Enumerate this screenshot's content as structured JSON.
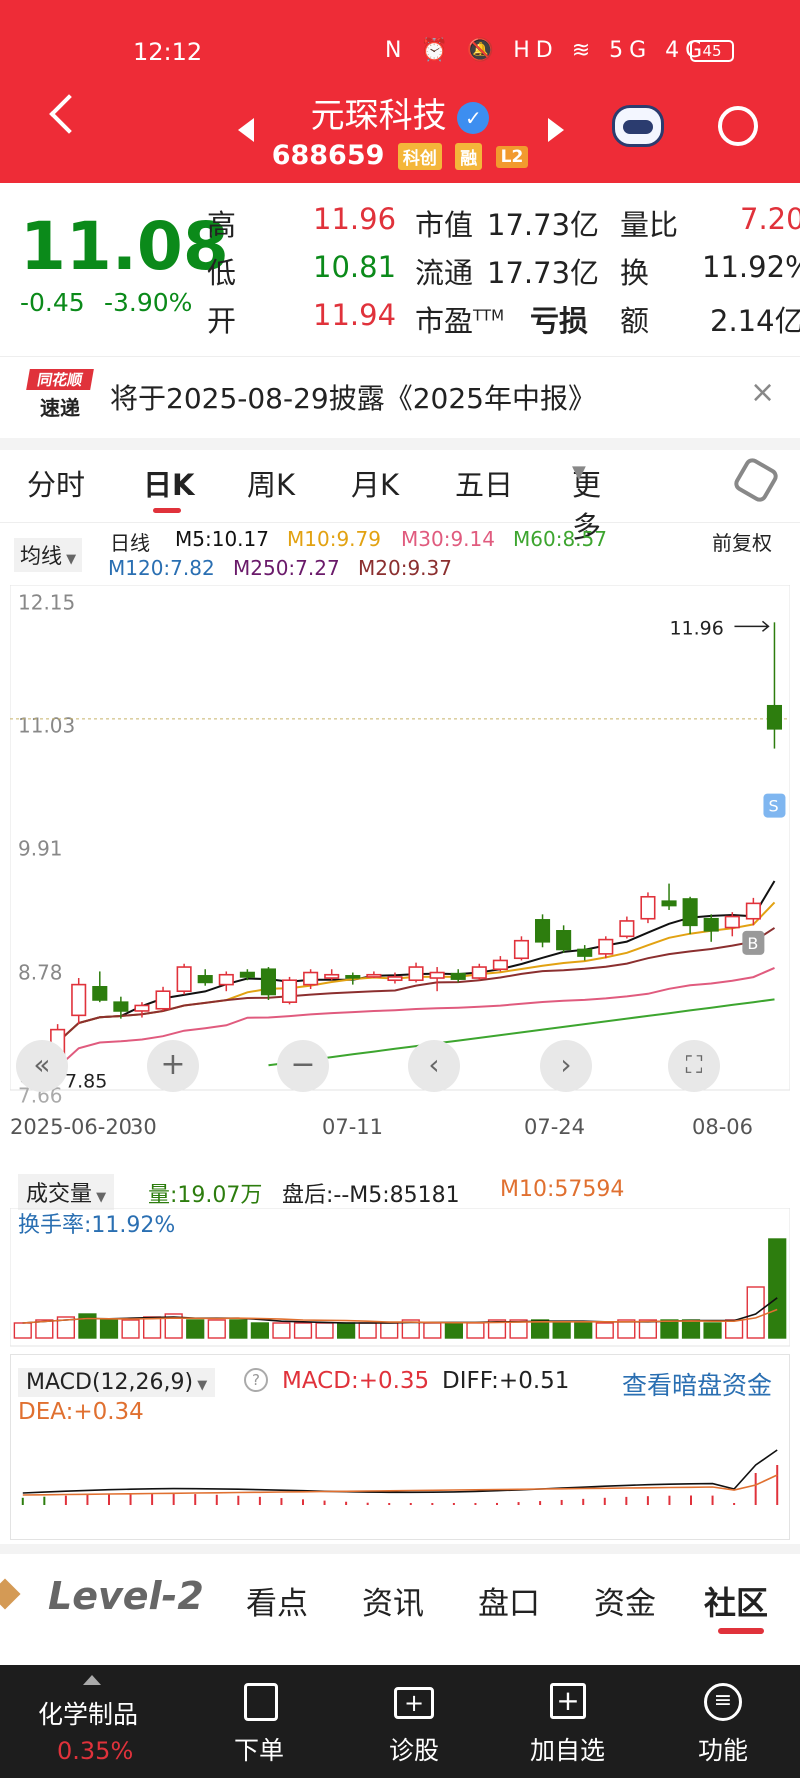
{
  "status": {
    "time": "12:12",
    "battery": "45"
  },
  "stock": {
    "name": "元琛科技",
    "code": "688659",
    "tags": [
      "科创",
      "融",
      "L2"
    ]
  },
  "quote": {
    "price": "11.08",
    "change": "-0.45",
    "change_pct": "-3.90%",
    "high_l": "高",
    "high": "11.96",
    "low_l": "低",
    "low": "10.81",
    "open_l": "开",
    "open": "11.94",
    "mcap_l": "市值",
    "mcap": "17.73亿",
    "float_l": "流通",
    "float": "17.73亿",
    "pe_l": "市盈",
    "pe_sup": "TTM",
    "pe": "亏损",
    "vr_l": "量比",
    "vr": "7.20",
    "tr_l": "换",
    "tr": "11.92%",
    "amt_l": "额",
    "amt": "2.14亿"
  },
  "notice": {
    "logo1": "同花顺",
    "logo2": "速递",
    "text": "将于2025-08-29披露《2025年中报》"
  },
  "tabs": [
    "分时",
    "日K",
    "周K",
    "月K",
    "五日",
    "更多"
  ],
  "ma": {
    "btn": "均线",
    "period": "日线",
    "adj": "前复权",
    "items": [
      "M5:10.17",
      "M10:9.79",
      "M30:9.14",
      "M60:8.57",
      "M120:7.82",
      "M250:7.27",
      "M20:9.37"
    ]
  },
  "colors": {
    "up": "#e0323b",
    "down": "#2d7d0e",
    "m5": "#111111",
    "m10": "#e2a212",
    "m20": "#8b2f2f",
    "m30": "#e05b7e",
    "m60": "#3da52f",
    "m120": "#2a6fb2",
    "m250": "#6a1a6a",
    "header": "#ee2c37"
  },
  "chart_data": {
    "type": "candlestick",
    "ylim": [
      7.7,
      12.3
    ],
    "yticks": [
      "12.15",
      "11.03",
      "9.91",
      "8.78"
    ],
    "xticks": [
      "2025-06-20",
      "30",
      "07-11",
      "07-24",
      "08-06"
    ],
    "max_label": "11.96",
    "min_label": "7.85",
    "partial_label": "7.66",
    "candles": [
      [
        7.95,
        8.02,
        8.06,
        7.85
      ],
      [
        8.02,
        8.25,
        8.3,
        7.98
      ],
      [
        8.38,
        8.66,
        8.72,
        8.3
      ],
      [
        8.64,
        8.52,
        8.78,
        8.5
      ],
      [
        8.5,
        8.42,
        8.55,
        8.35
      ],
      [
        8.42,
        8.47,
        8.5,
        8.36
      ],
      [
        8.44,
        8.6,
        8.64,
        8.42
      ],
      [
        8.6,
        8.82,
        8.85,
        8.57
      ],
      [
        8.74,
        8.68,
        8.8,
        8.65
      ],
      [
        8.66,
        8.75,
        8.78,
        8.6
      ],
      [
        8.77,
        8.73,
        8.8,
        8.7
      ],
      [
        8.8,
        8.57,
        8.82,
        8.52
      ],
      [
        8.5,
        8.7,
        8.73,
        8.48
      ],
      [
        8.66,
        8.77,
        8.8,
        8.62
      ],
      [
        8.72,
        8.75,
        8.8,
        8.7
      ],
      [
        8.74,
        8.73,
        8.77,
        8.66
      ],
      [
        8.73,
        8.75,
        8.78,
        8.72
      ],
      [
        8.7,
        8.73,
        8.77,
        8.67
      ],
      [
        8.7,
        8.82,
        8.86,
        8.68
      ],
      [
        8.72,
        8.77,
        8.82,
        8.6
      ],
      [
        8.76,
        8.71,
        8.8,
        8.68
      ],
      [
        8.72,
        8.82,
        8.85,
        8.7
      ],
      [
        8.8,
        8.88,
        8.92,
        8.78
      ],
      [
        8.9,
        9.06,
        9.1,
        8.88
      ],
      [
        9.25,
        9.05,
        9.3,
        9.0
      ],
      [
        9.15,
        8.98,
        9.2,
        8.95
      ],
      [
        8.98,
        8.92,
        9.02,
        8.88
      ],
      [
        8.94,
        9.07,
        9.1,
        8.9
      ],
      [
        9.1,
        9.24,
        9.28,
        9.08
      ],
      [
        9.26,
        9.46,
        9.5,
        9.22
      ],
      [
        9.42,
        9.38,
        9.58,
        9.34
      ],
      [
        9.44,
        9.2,
        9.46,
        9.12
      ],
      [
        9.26,
        9.15,
        9.3,
        9.05
      ],
      [
        9.18,
        9.28,
        9.32,
        9.1
      ],
      [
        9.26,
        9.4,
        9.45,
        9.2
      ],
      [
        11.2,
        10.99,
        11.96,
        10.81
      ]
    ],
    "vol": [
      0.5,
      0.6,
      0.7,
      0.8,
      0.6,
      0.6,
      0.7,
      0.8,
      0.6,
      0.6,
      0.6,
      0.5,
      0.5,
      0.5,
      0.5,
      0.5,
      0.5,
      0.5,
      0.6,
      0.5,
      0.5,
      0.5,
      0.6,
      0.6,
      0.6,
      0.5,
      0.5,
      0.5,
      0.6,
      0.6,
      0.6,
      0.6,
      0.5,
      0.6,
      1.7,
      3.3
    ]
  },
  "vol_panel": {
    "btn": "成交量",
    "vol": "量:19.07万",
    "after": "盘后:--M5:85181",
    "m10": "M10:57594",
    "turnover": "换手率:11.92%"
  },
  "macd_panel": {
    "btn": "MACD(12,26,9)",
    "macd": "MACD:+0.35",
    "diff": "DIFF:+0.51",
    "link": "查看暗盘资金",
    "dea": "DEA:+0.34"
  },
  "section_tabs": [
    "Level-2",
    "看点",
    "资讯",
    "盘口",
    "资金",
    "社区"
  ],
  "bottom": {
    "sector": "化学制品",
    "sector_pct": "0.35%",
    "items": [
      "下单",
      "诊股",
      "加自选",
      "功能"
    ]
  }
}
